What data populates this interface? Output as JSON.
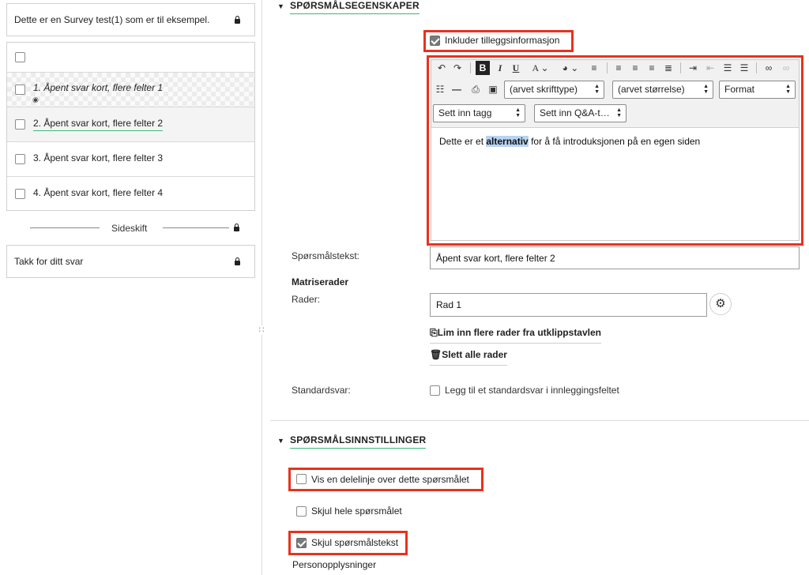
{
  "left": {
    "intro_text": "Dette er en Survey test(1) som er til eksempel.",
    "questions": [
      {
        "label": "1.  Åpent svar kort, flere felter 1",
        "hidden": true
      },
      {
        "label": "2.  Åpent svar kort, flere felter 2",
        "selected": true
      },
      {
        "label": "3.  Åpent svar kort, flere felter 3"
      },
      {
        "label": "4.  Åpent svar kort, flere felter 4"
      }
    ],
    "page_break": "Sideskift",
    "thanks_text": "Takk for ditt svar"
  },
  "props": {
    "section_title": "SPØRSMÅLSEGENSKAPER",
    "include_extra_label": "Inkluder tilleggsinformasjon",
    "include_extra_checked": true,
    "editor": {
      "font_family": "(arvet skrifttype)",
      "font_size": "(arvet størrelse)",
      "format": "Format",
      "insert_tag": "Sett inn tagg",
      "insert_qa": "Sett inn Q&A-t…",
      "content_before": "Dette er et ",
      "content_highlight": "alternativ",
      "content_after": " for å få introduksjonen på en egen siden"
    },
    "question_text_label": "Spørsmålstekst:",
    "question_text_value": "Åpent svar kort, flere felter 2",
    "matrix_heading": "Matriserader",
    "rows_label": "Rader:",
    "row_value": "Rad 1",
    "paste_rows": "Lim inn flere rader fra utklippstavlen",
    "delete_rows": "Slett alle rader",
    "default_answer_label": "Standardsvar:",
    "default_answer_option": "Legg til et standardsvar i innleggingsfeltet"
  },
  "settings": {
    "section_title": "SPØRSMÅLSINNSTILLINGER",
    "separator_label": "Vis en delelinje over dette spørsmålet",
    "hide_question_label": "Skjul hele spørsmålet",
    "hide_text_label": "Skjul spørsmålstekst",
    "hide_text_checked": true,
    "personal_info": "Personopplysninger"
  },
  "colors": {
    "highlight_red": "#e8321e",
    "accent_green": "#3cb878",
    "selection_blue": "#b7d3f3"
  }
}
